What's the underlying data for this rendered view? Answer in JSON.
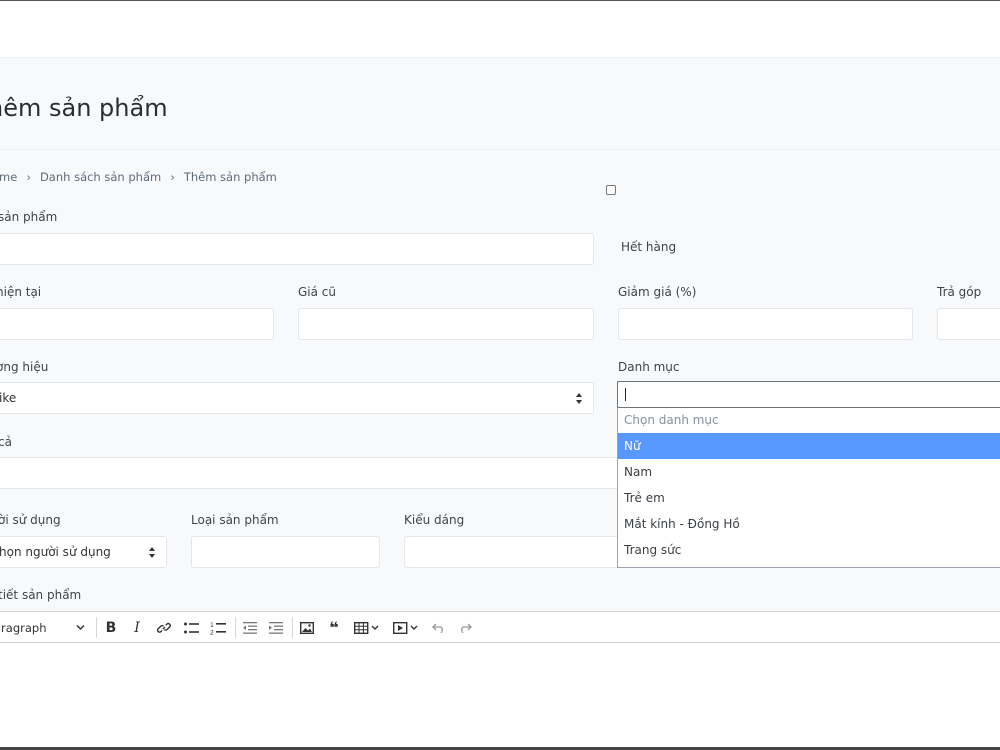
{
  "page": {
    "title": "hêm sản phẩm",
    "breadcrumb": [
      "ome",
      "Danh sách sản phẩm",
      "Thêm sản phẩm"
    ]
  },
  "form": {
    "name_label": "sản phẩm",
    "out_of_stock_label": "Hết hàng",
    "price_current_label": "hiện tại",
    "price_old_label": "Giá cũ",
    "discount_label": "Giảm giá (%)",
    "installment_label": "Trả góp",
    "brand_label": "ơng hiệu",
    "brand_value": "ike",
    "category_label": "Danh mục",
    "description_label": "cả",
    "user_label": "ời sử dụng",
    "user_value": "họn người sử dụng",
    "product_type_label": "Loại sản phẩm",
    "style_label": "Kiểu dáng",
    "detail_label": "tiết sản phẩm"
  },
  "category_dropdown": {
    "search_value": "",
    "options": [
      "Chọn danh mục",
      "Nữ",
      "Nam",
      "Trẻ em",
      "Mắt kính - Đồng Hồ",
      "Trang sức"
    ],
    "highlighted": "Nữ"
  },
  "editor_toolbar": {
    "heading_value": "aragraph",
    "buttons": [
      "bold-icon",
      "italic-icon",
      "link-icon",
      "bulleted-list-icon",
      "numbered-list-icon",
      "outdent-icon",
      "indent-icon",
      "image-icon",
      "quote-icon",
      "table-icon",
      "media-icon",
      "undo-icon",
      "redo-icon"
    ]
  },
  "colors": {
    "highlight": "#5897fb",
    "background": "#f8f9fb"
  }
}
